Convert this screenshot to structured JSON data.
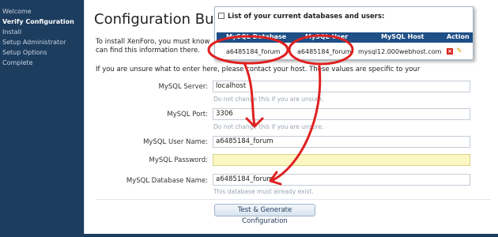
{
  "sidebar": {
    "items": [
      {
        "label": "Welcome",
        "active": false
      },
      {
        "label": "Verify Configuration",
        "active": true
      },
      {
        "label": "Install",
        "active": false
      },
      {
        "label": "Setup Administrator",
        "active": false
      },
      {
        "label": "Setup Options",
        "active": false
      },
      {
        "label": "Complete",
        "active": false
      }
    ]
  },
  "main": {
    "title": "Configuration Builde",
    "intro": "To install XenForo, you must know can find this information there.",
    "unsure": "If you are unsure what to enter here, please contact your host. These values are specific to your"
  },
  "form": {
    "server": {
      "label": "MySQL Server:",
      "value": "localhost",
      "hint": "Do not change this if you are unsure."
    },
    "port": {
      "label": "MySQL Port:",
      "value": "3306",
      "hint": "Do not change this if you are unsure."
    },
    "username": {
      "label": "MySQL User Name:",
      "value": "a6485184_forum"
    },
    "password": {
      "label": "MySQL Password:",
      "value": ""
    },
    "dbname": {
      "label": "MySQL Database Name:",
      "value": "a6485184_forum",
      "hint": "This database must already exist."
    },
    "submit_label": "Test & Generate Configuration"
  },
  "popup": {
    "heading": "List of your current databases and users:",
    "headers": {
      "db": "MySQL Database",
      "user": "MySQL User",
      "host": "MySQL Host",
      "action": "Action"
    },
    "row": {
      "db": "a6485184_forum",
      "user": "a6485184_forum",
      "host": "mysql12.000webhost.com"
    }
  },
  "colors": {
    "sidebar": "#1d3d5f",
    "header_bar": "#1e4f86",
    "annotation": "#e02020",
    "password_field": "#fcf6c4"
  }
}
